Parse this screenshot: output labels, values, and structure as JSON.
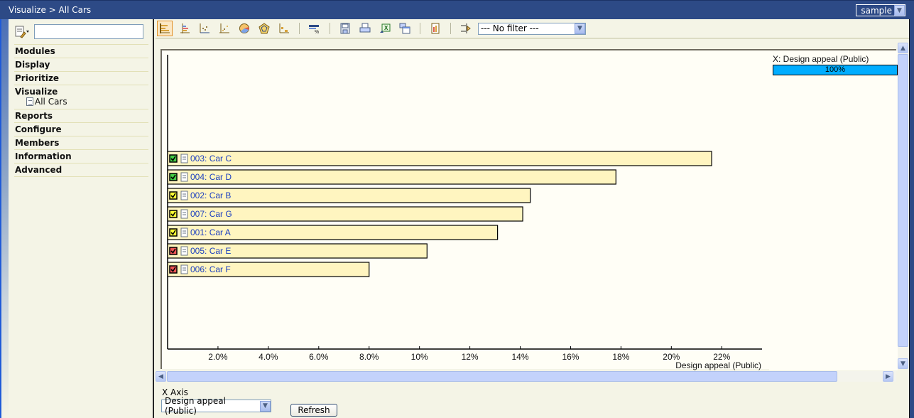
{
  "header": {
    "breadcrumb": "Visualize > All Cars",
    "project_select": "sample"
  },
  "sidebar": {
    "search_placeholder": "",
    "items": [
      {
        "label": "Modules"
      },
      {
        "label": "Display"
      },
      {
        "label": "Prioritize"
      },
      {
        "label": "Visualize",
        "children": [
          {
            "label": "All Cars"
          }
        ]
      },
      {
        "label": "Reports"
      },
      {
        "label": "Configure"
      },
      {
        "label": "Members"
      },
      {
        "label": "Information"
      },
      {
        "label": "Advanced"
      }
    ]
  },
  "toolbar": {
    "buttons": [
      {
        "icon": "bar-chart-icon",
        "active": true
      },
      {
        "icon": "stacked-bar-icon"
      },
      {
        "icon": "scatter-icon"
      },
      {
        "icon": "bubble-scatter-icon"
      },
      {
        "icon": "pie-chart-icon"
      },
      {
        "icon": "radar-chart-icon"
      },
      {
        "icon": "step-chart-icon"
      },
      {
        "icon": "percent-settings-icon"
      },
      {
        "icon": "save-icon"
      },
      {
        "icon": "print-icon"
      },
      {
        "icon": "export-excel-icon"
      },
      {
        "icon": "copy-window-icon"
      },
      {
        "icon": "report-icon"
      },
      {
        "icon": "filter-arrow-icon"
      }
    ],
    "filter_select": "--- No filter ---"
  },
  "chart_data": {
    "type": "bar",
    "orientation": "horizontal",
    "categories": [
      "003: Car C",
      "004: Car D",
      "002: Car B",
      "007: Car G",
      "001: Car A",
      "005: Car E",
      "006: Car F"
    ],
    "status_colors": [
      "#44cc44",
      "#44cc44",
      "#ffff33",
      "#ffff33",
      "#ffff33",
      "#ee5555",
      "#ee5555"
    ],
    "values": [
      21.6,
      17.8,
      14.4,
      14.1,
      13.1,
      10.3,
      8.0
    ],
    "xlabel": "Design appeal (Public)",
    "ylabel": "",
    "xlim": [
      0,
      23.6
    ],
    "xticks": [
      2,
      4,
      6,
      8,
      10,
      12,
      14,
      16,
      18,
      20,
      22
    ],
    "xtick_labels": [
      "2.0%",
      "4.0%",
      "6.0%",
      "8.0%",
      "10%",
      "12%",
      "14%",
      "16%",
      "18%",
      "20%",
      "22%"
    ],
    "bar_color": "#fff5c0",
    "grid": false
  },
  "legend": {
    "title": "X: Design appeal (Public)",
    "weight_label": "100%",
    "weight": 100,
    "color": "#00adff"
  },
  "bottom": {
    "x_axis_label": "X Axis",
    "x_axis_select": "Design appeal (Public)",
    "refresh_label": "Refresh"
  }
}
